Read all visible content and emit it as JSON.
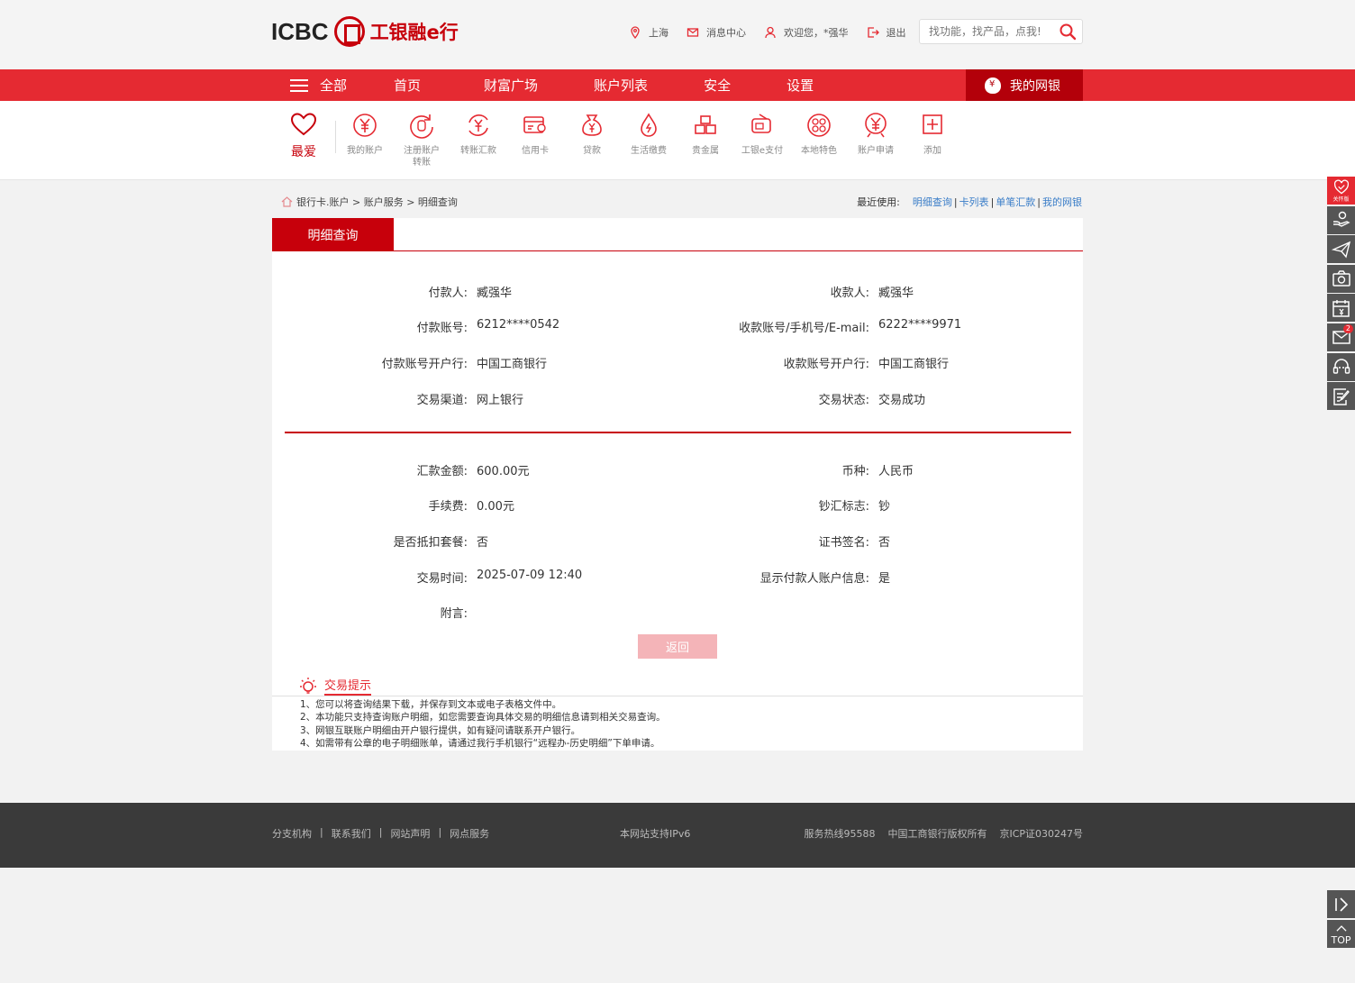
{
  "header": {
    "logo_text": "ICBC",
    "logo_cn": "工银融e行",
    "location": "上海",
    "message_center": "消息中心",
    "welcome": "欢迎您，*强华",
    "logout": "退出",
    "search_placeholder": "找功能，找产品，点我!"
  },
  "nav": {
    "all": "全部",
    "items": [
      "首页",
      "财富广场",
      "账户列表",
      "安全",
      "设置"
    ],
    "mine": "我的网银"
  },
  "quick": {
    "fav": "最爱",
    "items": [
      {
        "label": "我的账户",
        "icon": "yen-circle-icon"
      },
      {
        "label": "注册账户转账",
        "icon": "transfer-circle-icon"
      },
      {
        "label": "转账汇款",
        "icon": "remit-icon"
      },
      {
        "label": "信用卡",
        "icon": "credit-card-icon"
      },
      {
        "label": "贷款",
        "icon": "loan-bag-icon"
      },
      {
        "label": "生活缴费",
        "icon": "drop-icon"
      },
      {
        "label": "贵金属",
        "icon": "gold-bars-icon"
      },
      {
        "label": "工银e支付",
        "icon": "epay-icon"
      },
      {
        "label": "本地特色",
        "icon": "local-icon"
      },
      {
        "label": "账户申请",
        "icon": "apply-icon"
      },
      {
        "label": "添加",
        "icon": "add-icon"
      }
    ]
  },
  "breadcrumb": {
    "path": "银行卡.账户 > 账户服务 > 明细查询",
    "recent_label": "最近使用:",
    "recent": [
      "明细查询",
      "卡列表",
      "单笔汇款",
      "我的网银"
    ]
  },
  "tab": {
    "active": "明细查询"
  },
  "details": {
    "payer_label": "付款人:",
    "payer": "臧强华",
    "payee_label": "收款人:",
    "payee": "臧强华",
    "payer_acct_label": "付款账号:",
    "payer_acct": "6212****0542",
    "payee_acct_label": "收款账号/手机号/E-mail:",
    "payee_acct": "6222****9971",
    "payer_bank_label": "付款账号开户行:",
    "payer_bank": "中国工商银行",
    "payee_bank_label": "收款账号开户行:",
    "payee_bank": "中国工商银行",
    "channel_label": "交易渠道:",
    "channel": "网上银行",
    "status_label": "交易状态:",
    "status": "交易成功",
    "amount_label": "汇款金额:",
    "amount": "600.00元",
    "currency_label": "币种:",
    "currency": "人民币",
    "fee_label": "手续费:",
    "fee": "0.00元",
    "cash_label": "钞汇标志:",
    "cash": "钞",
    "package_label": "是否抵扣套餐:",
    "package": "否",
    "cert_label": "证书签名:",
    "cert": "否",
    "time_label": "交易时间:",
    "time": "2025-07-09 12:40",
    "show_payer_label": "显示付款人账户信息:",
    "show_payer": "是",
    "memo_label": "附言:",
    "memo": "",
    "back_button": "返回"
  },
  "tips": {
    "title": "交易提示",
    "lines": [
      "1、您可以将查询结果下载，并保存到文本或电子表格文件中。",
      "2、本功能只支持查询账户明细，如您需要查询具体交易的明细信息请到相关交易查询。",
      "3、网银互联账户明细由开户银行提供，如有疑问请联系开户银行。",
      "4、如需带有公章的电子明细账单，请通过我行手机银行“远程办-历史明细”下单申请。"
    ]
  },
  "footer": {
    "links": [
      "分支机构",
      "联系我们",
      "网站声明",
      "网点服务"
    ],
    "ipv6": "本网站支持IPv6",
    "right": "服务热线95588    中国工商银行版权所有    京ICP证030247号"
  },
  "side": {
    "elder_label": "关怀版",
    "msg_badge": "2",
    "top_label": "TOP"
  },
  "colors": {
    "brand_red": "#e52a32",
    "dark_red": "#c7000b",
    "link_blue": "#3a7dc8"
  }
}
